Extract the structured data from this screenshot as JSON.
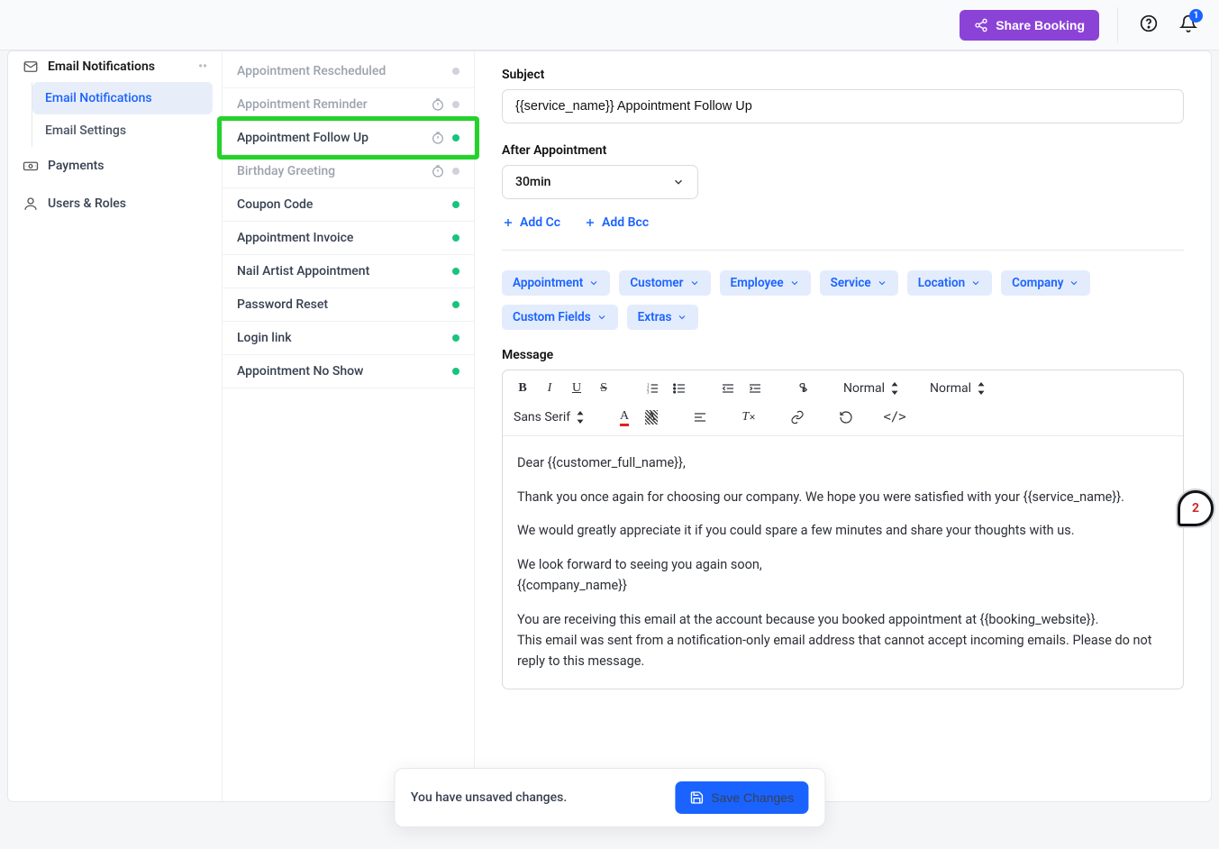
{
  "topbar": {
    "share_label": "Share Booking",
    "bell_badge": "1"
  },
  "sidebar": {
    "parent_label": "Email Notifications",
    "sub_email_notif": "Email Notifications",
    "sub_email_settings": "Email Settings",
    "payments": "Payments",
    "users_roles": "Users & Roles"
  },
  "notif_list": [
    {
      "label": "Appointment Rescheduled",
      "timer": false,
      "status": "grey",
      "greyed": true
    },
    {
      "label": "Appointment Reminder",
      "timer": true,
      "status": "grey",
      "greyed": true
    },
    {
      "label": "Appointment Follow Up",
      "timer": true,
      "status": "green",
      "highlight": true
    },
    {
      "label": "Birthday Greeting",
      "timer": true,
      "status": "grey",
      "greyed": true
    },
    {
      "label": "Coupon Code",
      "timer": false,
      "status": "green"
    },
    {
      "label": "Appointment Invoice",
      "timer": false,
      "status": "green"
    },
    {
      "label": "Nail Artist Appointment",
      "timer": false,
      "status": "green"
    },
    {
      "label": "Password Reset",
      "timer": false,
      "status": "green"
    },
    {
      "label": "Login link",
      "timer": false,
      "status": "green"
    },
    {
      "label": "Appointment No Show",
      "timer": false,
      "status": "green"
    }
  ],
  "form": {
    "subject_label": "Subject",
    "subject_value": "{{service_name}} Appointment Follow Up",
    "after_label": "After Appointment",
    "after_value": "30min",
    "add_cc": "Add Cc",
    "add_bcc": "Add Bcc",
    "tags": [
      "Appointment",
      "Customer",
      "Employee",
      "Service",
      "Location",
      "Company",
      "Custom Fields",
      "Extras"
    ],
    "message_label": "Message",
    "toolbar": {
      "heading1": "Normal",
      "heading2": "Normal",
      "font": "Sans Serif"
    },
    "body": {
      "p1": "Dear {{customer_full_name}},",
      "p2": "Thank you once again for choosing our company. We hope you were satisfied with your {{service_name}}.",
      "p3": "We would greatly appreciate it if you could spare a few minutes and share your thoughts with us.",
      "p4a": "We look forward to seeing you again soon,",
      "p4b": "{{company_name}}",
      "p5a": "You are receiving this email at the account because you booked appointment at {{booking_website}}.",
      "p5b": "This email was sent from a notification-only email address that cannot accept incoming emails. Please do not reply to this message."
    }
  },
  "save_bar": {
    "msg": "You have unsaved changes.",
    "btn": "Save Changes"
  },
  "bubble_count": "2"
}
